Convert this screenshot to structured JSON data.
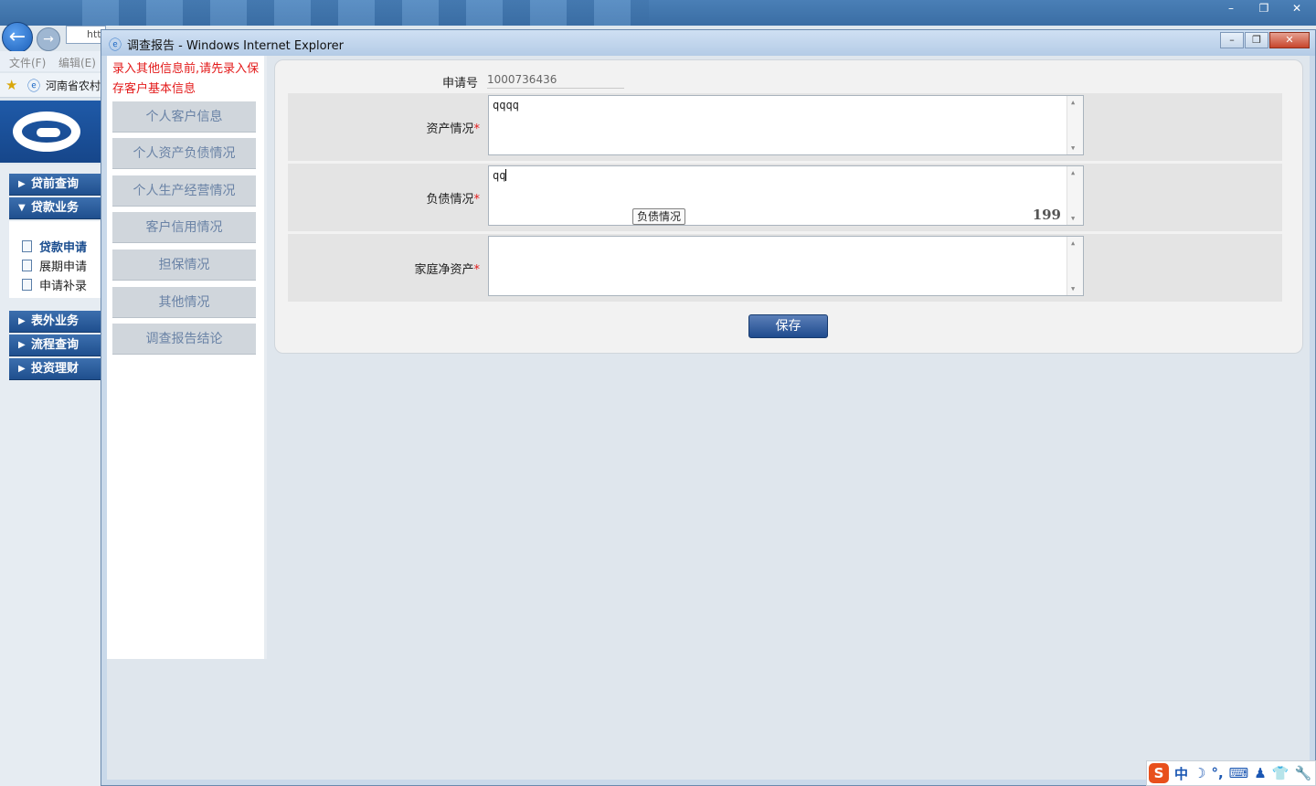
{
  "browser": {
    "address_fragment": "htt",
    "menu": [
      "文件(F)",
      "编辑(E)"
    ],
    "favorite": "河南省农村",
    "window_controls": [
      "–",
      "❐",
      "✕"
    ]
  },
  "sidebar": {
    "sections": [
      {
        "label": "贷前查询",
        "arrow": "▶"
      },
      {
        "label": "贷款业务",
        "arrow": "▼"
      },
      {
        "label": "表外业务",
        "arrow": "▶"
      },
      {
        "label": "流程查询",
        "arrow": "▶"
      },
      {
        "label": "投资理财",
        "arrow": "▶"
      }
    ],
    "sub_items": [
      "贷款申请",
      "展期申请",
      "申请补录"
    ]
  },
  "popup": {
    "title": "调查报告 - Windows Internet Explorer",
    "controls": [
      "–",
      "❐",
      "✕"
    ]
  },
  "left_panel": {
    "warning": "录入其他信息前,请先录入保存客户基本信息",
    "nav": [
      "个人客户信息",
      "个人资产负债情况",
      "个人生产经营情况",
      "客户信用情况",
      "担保情况",
      "其他情况",
      "调查报告结论"
    ]
  },
  "form": {
    "app_no_label": "申请号",
    "app_no_value": "1000736436",
    "asset_label": "资产情况",
    "asset_value": "qqqq",
    "debt_label": "负债情况",
    "debt_value": "qq",
    "debt_tooltip": "负债情况",
    "debt_counter": "199",
    "net_label": "家庭净资产",
    "net_value": "",
    "required_mark": "*",
    "save_label": "保存"
  },
  "tray": {
    "logo": "S",
    "items": [
      "中",
      "☽",
      "°,",
      "⌨",
      "♟",
      "👕",
      "🔧"
    ]
  }
}
